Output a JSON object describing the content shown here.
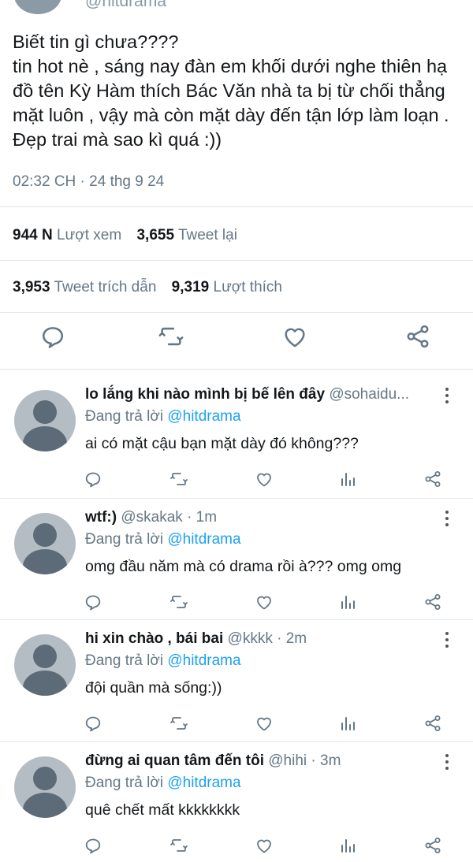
{
  "header": {
    "handle": "@hitdrama"
  },
  "tweet": {
    "text": "Biết tin gì chưa????\ntin hot nè , sáng nay đàn em khối dưới nghe thiên hạ đồ tên Kỳ Hàm thích Bác Văn nhà ta bị từ chối thẳng mặt luôn , vậy mà còn mặt dày đến tận lớp làm loạn . Đẹp trai mà sao kì quá :))",
    "time": "02:32 CH · 24 thg 9 24",
    "views_count": "944 N",
    "views_label": "Lượt xem",
    "retweets_count": "3,655",
    "retweets_label": "Tweet lại",
    "quotes_count": "3,953",
    "quotes_label": "Tweet trích dẫn",
    "likes_count": "9,319",
    "likes_label": "Lượt thích"
  },
  "icons": {
    "reply": "reply-icon",
    "retweet": "retweet-icon",
    "like": "heart-icon",
    "share": "share-icon",
    "analytics": "analytics-icon",
    "more": "more-vertical-icon"
  },
  "colors": {
    "link": "#1da1f2",
    "secondary_text": "#657786",
    "icon": "#657786",
    "divider": "#e1e8ed"
  },
  "replying_prefix": "Đang trả lời",
  "replies": [
    {
      "name": "lo lắng khi nào mình bị bế lên đây",
      "handle_time": "@sohaidu...",
      "mention": "@hitdrama",
      "text": "ai có mặt cậu bạn mặt dày đó không???"
    },
    {
      "name": "wtf:)",
      "handle_time": "@skakak · 1m",
      "mention": "@hitdrama",
      "text": "omg đầu năm mà có drama rồi à??? omg omg"
    },
    {
      "name": "hi xin chào , bái bai",
      "handle_time": "@kkkk · 2m",
      "mention": "@hitdrama",
      "text": "đội quần mà sống:))"
    },
    {
      "name": "đừng ai quan tâm đến tôi",
      "handle_time": "@hihi · 3m",
      "mention": "@hitdrama",
      "text": "quê chết mất kkkkkkkk"
    }
  ]
}
